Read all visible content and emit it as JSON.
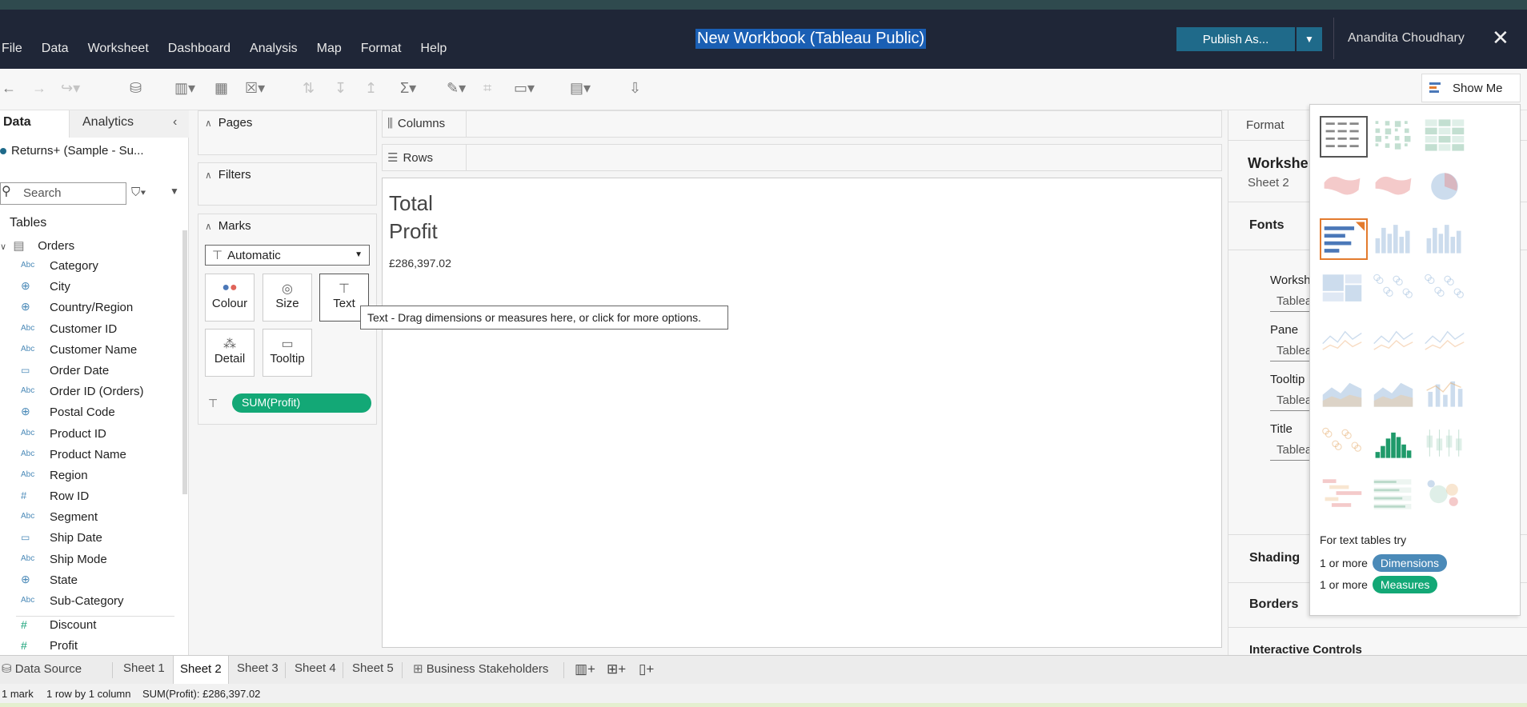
{
  "app": {
    "menu": [
      "File",
      "Data",
      "Worksheet",
      "Dashboard",
      "Analysis",
      "Map",
      "Format",
      "Help"
    ],
    "workbook_title": "New Workbook (Tableau Public)",
    "publish_label": "Publish As...",
    "user_name": "Anandita Choudhary"
  },
  "data_pane": {
    "tab_data": "Data",
    "tab_analytics": "Analytics",
    "data_source": "Returns+ (Sample - Su...",
    "search_placeholder": "Search",
    "tables_label": "Tables",
    "table_name": "Orders",
    "fields": [
      {
        "type": "Abc",
        "name": "Category"
      },
      {
        "type": "geo",
        "name": "City"
      },
      {
        "type": "geo",
        "name": "Country/Region"
      },
      {
        "type": "Abc",
        "name": "Customer ID"
      },
      {
        "type": "Abc",
        "name": "Customer Name"
      },
      {
        "type": "date",
        "name": "Order Date"
      },
      {
        "type": "Abc",
        "name": "Order ID (Orders)"
      },
      {
        "type": "geo",
        "name": "Postal Code"
      },
      {
        "type": "Abc",
        "name": "Product ID"
      },
      {
        "type": "Abc",
        "name": "Product Name"
      },
      {
        "type": "Abc",
        "name": "Region"
      },
      {
        "type": "#",
        "name": "Row ID"
      },
      {
        "type": "Abc",
        "name": "Segment"
      },
      {
        "type": "date",
        "name": "Ship Date"
      },
      {
        "type": "Abc",
        "name": "Ship Mode"
      },
      {
        "type": "geo",
        "name": "State"
      },
      {
        "type": "Abc",
        "name": "Sub-Category"
      }
    ],
    "measures": [
      {
        "type": "#",
        "name": "Discount"
      },
      {
        "type": "#",
        "name": "Profit"
      }
    ]
  },
  "cards": {
    "pages": "Pages",
    "filters": "Filters",
    "marks": "Marks",
    "marks_type": "Automatic",
    "mark_buttons": [
      "Colour",
      "Size",
      "Text",
      "Detail",
      "Tooltip"
    ],
    "pill": "SUM(Profit)"
  },
  "shelves": {
    "columns": "Columns",
    "rows": "Rows"
  },
  "viz": {
    "title": "Total\nProfit",
    "value": "£286,397.02"
  },
  "tooltip": "Text - Drag dimensions or measures here, or click for more options.",
  "format_pane": {
    "title": "Format",
    "worksheet": "Workshe",
    "sheet": "Sheet 2",
    "sections": [
      "Fonts",
      "Shading",
      "Borders",
      "Interactive Controls"
    ],
    "font_items": [
      {
        "label": "Worksh",
        "value": "Tablea"
      },
      {
        "label": "Pane",
        "value": "Tablea"
      },
      {
        "label": "Tooltip",
        "value": "Tablea"
      },
      {
        "label": "Title",
        "value": "Tablea"
      }
    ]
  },
  "show_me": {
    "button": "Show Me",
    "hint": "For text tables try",
    "row1_prefix": "1 or more",
    "row1_pill": "Dimensions",
    "row2_prefix": "1 or more",
    "row2_pill": "Measures"
  },
  "sheet_tabs": [
    "Data Source",
    "Sheet 1",
    "Sheet 2",
    "Sheet 3",
    "Sheet 4",
    "Sheet 5",
    "Business Stakeholders"
  ],
  "active_sheet": "Sheet 2",
  "status": {
    "marks": "1 mark",
    "dims": "1 row by 1 column",
    "sum": "SUM(Profit): £286,397.02"
  },
  "colors": {
    "titlebar": "#1f2637",
    "publish": "#1f6a8a",
    "measure_green": "#13a876",
    "dimension_blue": "#4b8ab8",
    "selected_orange": "#e37b2e"
  }
}
